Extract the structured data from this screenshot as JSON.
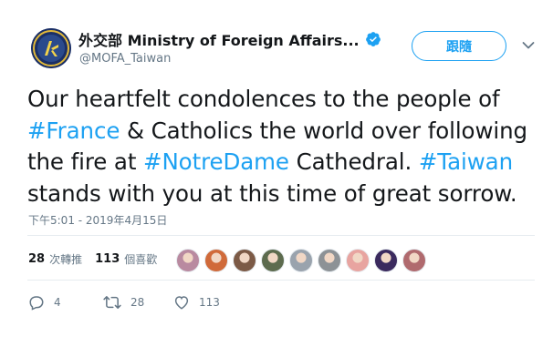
{
  "account": {
    "name": "外交部 Ministry of Foreign Affairs...",
    "handle": "@MOFA_Taiwan",
    "verified": true,
    "avatar_icon": "mofa-logo-icon"
  },
  "follow_button": {
    "label": "跟隨"
  },
  "tweet": {
    "segments": [
      {
        "text": "Our heartfelt condolences to the people of",
        "hashtag": false
      },
      {
        "text": "#France",
        "hashtag": true
      },
      {
        "text": " & Catholics the world over following",
        "hashtag": false
      },
      {
        "text": "the fire at ",
        "hashtag": false
      },
      {
        "text": "#NotreDame",
        "hashtag": true
      },
      {
        "text": " Cathedral. ",
        "hashtag": false
      },
      {
        "text": "#Taiwan",
        "hashtag": true
      },
      {
        "text": "stands with you at this time of great sorrow.",
        "hashtag": false
      }
    ],
    "timestamp": "下午5:01 - 2019年4月15日"
  },
  "stats": {
    "retweets_count": "28",
    "retweets_label": "次轉推",
    "likes_count": "113",
    "likes_label": "個喜歡"
  },
  "liker_avatars": [
    {
      "color": "#b98aa0"
    },
    {
      "color": "#d06a3a"
    },
    {
      "color": "#7c5a46"
    },
    {
      "color": "#5d6b4e"
    },
    {
      "color": "#9aa3ad"
    },
    {
      "color": "#8d9296"
    },
    {
      "color": "#e8a4a0"
    },
    {
      "color": "#3b2a5e"
    },
    {
      "color": "#b06a6e"
    }
  ],
  "actions": {
    "reply_count": "4",
    "retweet_count": "28",
    "like_count": "113"
  },
  "colors": {
    "accent": "#1da1f2",
    "text": "#14171a",
    "muted": "#657786",
    "verified": "#1da1f2"
  }
}
